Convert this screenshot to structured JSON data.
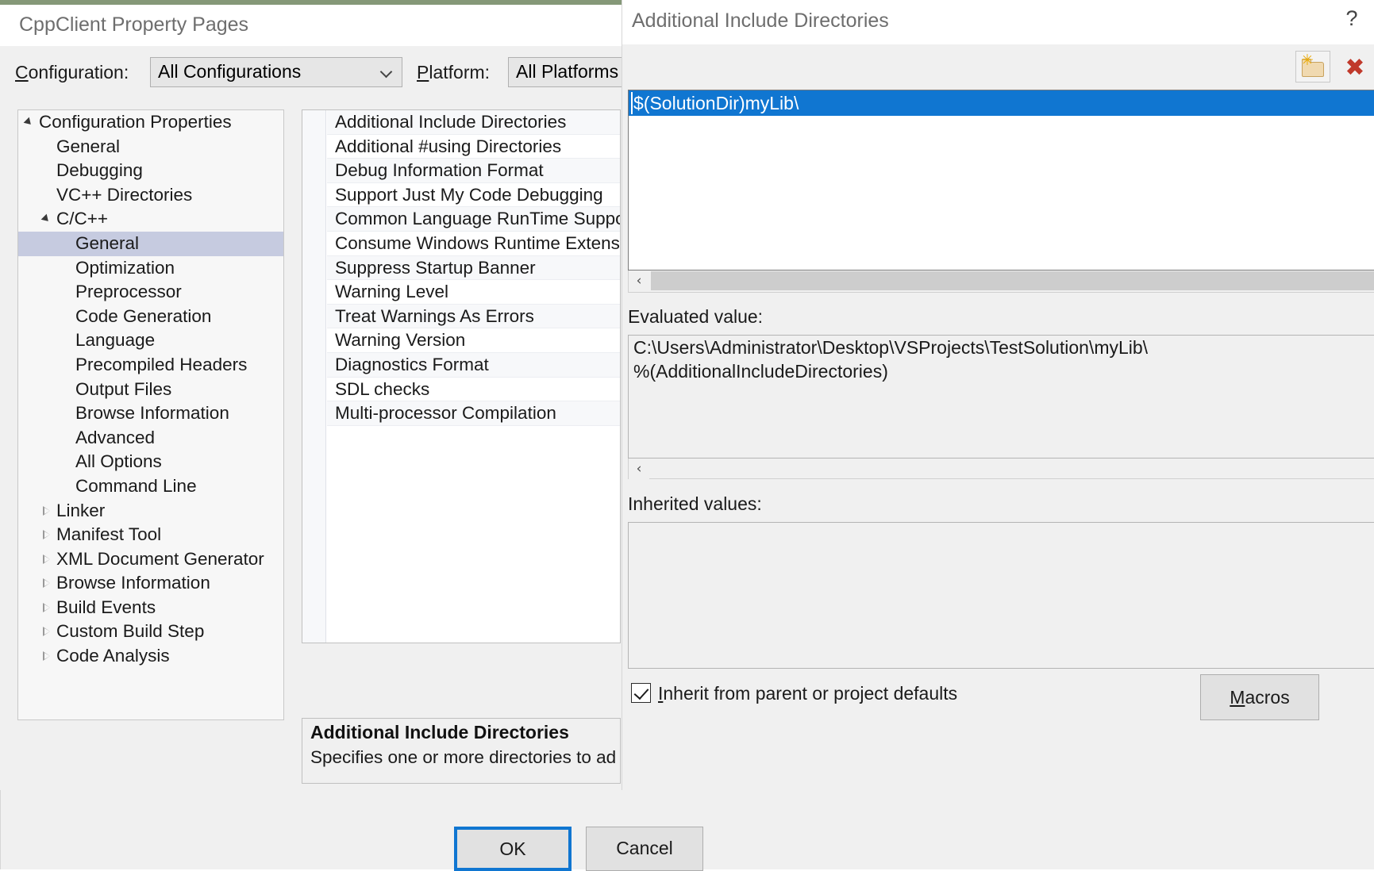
{
  "property_pages": {
    "title": "CppClient Property Pages",
    "config_bar": {
      "configuration_label": "Configuration:",
      "configuration_accel": "C",
      "configuration_value": "All Configurations",
      "platform_label": "Platform:",
      "platform_accel": "P",
      "platform_value": "All Platforms"
    },
    "tree": [
      {
        "label": "Configuration Properties",
        "indent": 0,
        "twisty": "expanded",
        "selected": false
      },
      {
        "label": "General",
        "indent": 1,
        "twisty": "none",
        "selected": false
      },
      {
        "label": "Debugging",
        "indent": 1,
        "twisty": "none",
        "selected": false
      },
      {
        "label": "VC++ Directories",
        "indent": 1,
        "twisty": "none",
        "selected": false
      },
      {
        "label": "C/C++",
        "indent": 1,
        "twisty": "expanded",
        "selected": false
      },
      {
        "label": "General",
        "indent": 2,
        "twisty": "none",
        "selected": true
      },
      {
        "label": "Optimization",
        "indent": 2,
        "twisty": "none",
        "selected": false
      },
      {
        "label": "Preprocessor",
        "indent": 2,
        "twisty": "none",
        "selected": false
      },
      {
        "label": "Code Generation",
        "indent": 2,
        "twisty": "none",
        "selected": false
      },
      {
        "label": "Language",
        "indent": 2,
        "twisty": "none",
        "selected": false
      },
      {
        "label": "Precompiled Headers",
        "indent": 2,
        "twisty": "none",
        "selected": false
      },
      {
        "label": "Output Files",
        "indent": 2,
        "twisty": "none",
        "selected": false
      },
      {
        "label": "Browse Information",
        "indent": 2,
        "twisty": "none",
        "selected": false
      },
      {
        "label": "Advanced",
        "indent": 2,
        "twisty": "none",
        "selected": false
      },
      {
        "label": "All Options",
        "indent": 2,
        "twisty": "none",
        "selected": false
      },
      {
        "label": "Command Line",
        "indent": 2,
        "twisty": "none",
        "selected": false
      },
      {
        "label": "Linker",
        "indent": 1,
        "twisty": "collapsed",
        "selected": false
      },
      {
        "label": "Manifest Tool",
        "indent": 1,
        "twisty": "collapsed",
        "selected": false
      },
      {
        "label": "XML Document Generator",
        "indent": 1,
        "twisty": "collapsed",
        "selected": false
      },
      {
        "label": "Browse Information",
        "indent": 1,
        "twisty": "collapsed",
        "selected": false
      },
      {
        "label": "Build Events",
        "indent": 1,
        "twisty": "collapsed",
        "selected": false
      },
      {
        "label": "Custom Build Step",
        "indent": 1,
        "twisty": "collapsed",
        "selected": false
      },
      {
        "label": "Code Analysis",
        "indent": 1,
        "twisty": "collapsed",
        "selected": false
      }
    ],
    "properties": [
      "Additional Include Directories",
      "Additional #using Directories",
      "Debug Information Format",
      "Support Just My Code Debugging",
      "Common Language RunTime Support",
      "Consume Windows Runtime Extension",
      "Suppress Startup Banner",
      "Warning Level",
      "Treat Warnings As Errors",
      "Warning Version",
      "Diagnostics Format",
      "SDL checks",
      "Multi-processor Compilation"
    ],
    "description": {
      "title": "Additional Include Directories",
      "text": "Specifies one or more directories to ad"
    }
  },
  "dialog": {
    "title": "Additional Include Directories",
    "help_glyph": "?",
    "toolbar": {
      "new_folder_label": "New Line",
      "new_folder_glyph": "✳",
      "delete_label": "Delete",
      "delete_glyph": "✖"
    },
    "list": {
      "items": [
        "$(SolutionDir)myLib\\"
      ],
      "scroll_left_glyph": "‹"
    },
    "evaluated": {
      "label": "Evaluated value:",
      "lines": [
        "C:\\Users\\Administrator\\Desktop\\VSProjects\\TestSolution\\myLib\\",
        "%(AdditionalIncludeDirectories)"
      ],
      "scroll_left_glyph": "‹"
    },
    "inherited": {
      "label": "Inherited values:",
      "lines": []
    },
    "inherit_checkbox": {
      "label": "Inherit from parent or project defaults",
      "accel": "I",
      "checked": true
    },
    "buttons": {
      "macros": "Macros",
      "macros_accel": "M",
      "ok": "OK",
      "cancel": "Cancel"
    }
  },
  "colors": {
    "selection_blue": "#1076d1",
    "tree_selection": "#c6cbe0",
    "dialog_bg": "#f0f0f0",
    "title_gray": "#6e6e6e"
  }
}
